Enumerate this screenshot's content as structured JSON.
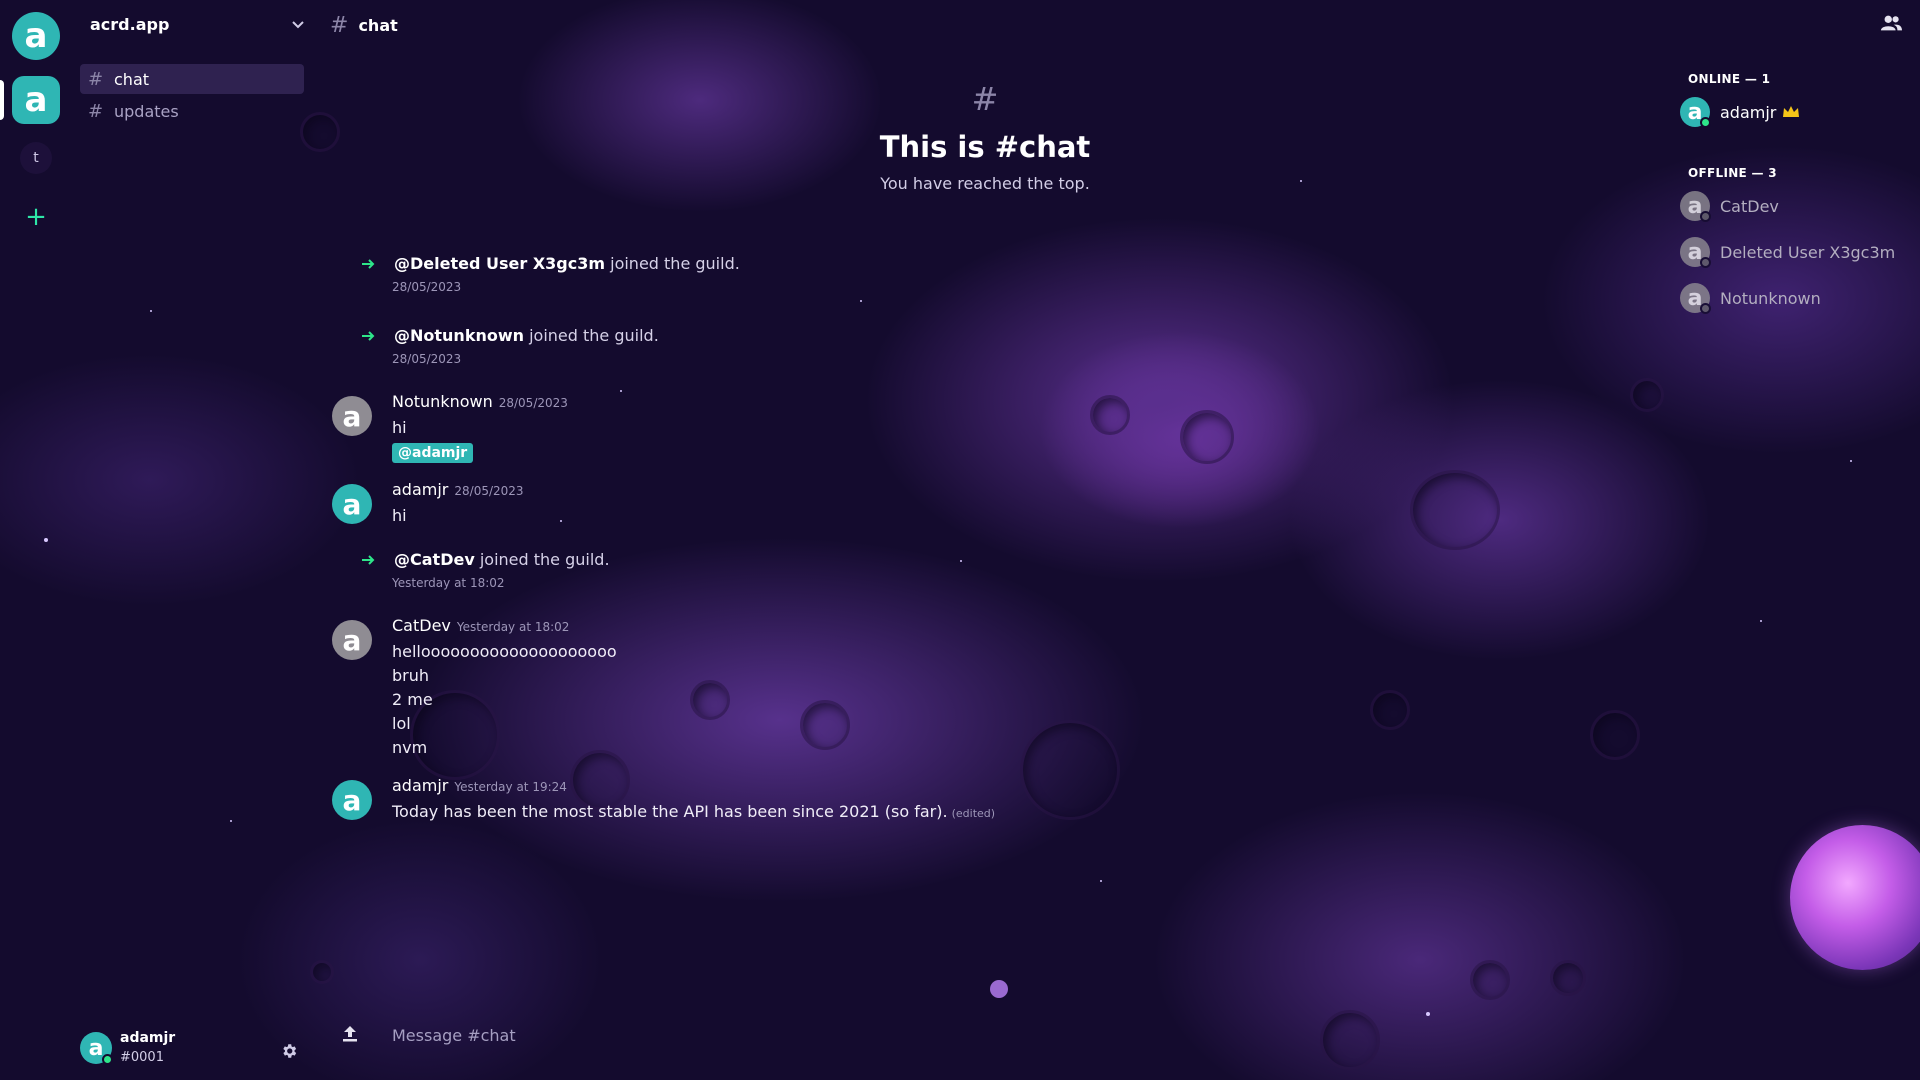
{
  "rail": {
    "home_letter": "a",
    "servers": [
      {
        "letter": "a",
        "active": true
      },
      {
        "letter": "t",
        "active": false
      }
    ],
    "add_label": "+"
  },
  "guild": {
    "name": "acrd.app",
    "channels": [
      {
        "name": "chat",
        "active": true
      },
      {
        "name": "updates",
        "active": false
      }
    ]
  },
  "current_user": {
    "avatar_letter": "a",
    "name": "adamjr",
    "tag": "#0001"
  },
  "topbar": {
    "channel": "chat"
  },
  "welcome": {
    "hash": "#",
    "title": "This is #chat",
    "subtitle": "You have reached the top."
  },
  "messages": [
    {
      "type": "join",
      "user": "@Deleted User X3gc3m",
      "text": "joined the guild.",
      "time": "28/05/2023"
    },
    {
      "type": "join",
      "user": "@Notunknown",
      "text": "joined the guild.",
      "time": "28/05/2023"
    },
    {
      "type": "message",
      "author": "Notunknown",
      "avatar": "grey",
      "time": "28/05/2023",
      "lines": [
        "hi"
      ],
      "mention": "@adamjr"
    },
    {
      "type": "message",
      "author": "adamjr",
      "avatar": "teal",
      "time": "28/05/2023",
      "lines": [
        "hi"
      ]
    },
    {
      "type": "join",
      "user": "@CatDev",
      "text": "joined the guild.",
      "time": "Yesterday at 18:02"
    },
    {
      "type": "message",
      "author": "CatDev",
      "avatar": "grey",
      "time": "Yesterday at 18:02",
      "lines": [
        "helloooooooooooooooooooo",
        "bruh",
        "2 me",
        "lol",
        "nvm"
      ]
    },
    {
      "type": "message",
      "author": "adamjr",
      "avatar": "teal",
      "time": "Yesterday at 19:24",
      "lines": [
        "Today has been the most stable the API has been since 2021 (so far)."
      ],
      "edited": "(edited)"
    }
  ],
  "composer": {
    "placeholder": "Message #chat"
  },
  "members": {
    "online_header": "ONLINE — 1",
    "offline_header": "OFFLINE — 3",
    "online": [
      {
        "name": "adamjr",
        "owner": true
      }
    ],
    "offline": [
      {
        "name": "CatDev"
      },
      {
        "name": "Deleted User X3gc3m"
      },
      {
        "name": "Notunknown"
      }
    ]
  },
  "colors": {
    "accent": "#2fb6b4",
    "online": "#2ee68a",
    "add": "#2ee6a8",
    "crown": "#f5c518"
  },
  "icons": {
    "chevron": "chevron-down-icon",
    "members": "members-icon",
    "settings": "gear-icon",
    "upload": "upload-icon",
    "join": "arrow-right-icon",
    "owner": "crown-icon"
  }
}
